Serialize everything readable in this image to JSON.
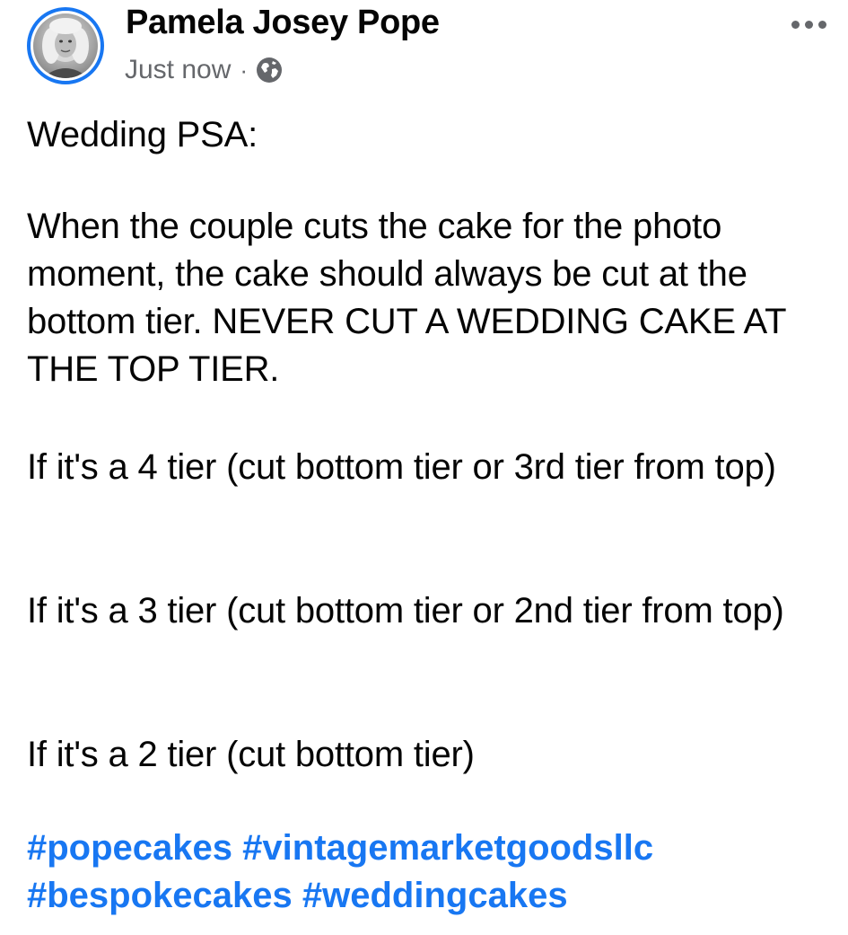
{
  "post": {
    "author": {
      "name": "Pamela Josey Pope",
      "avatar_icon": "profile-photo",
      "avatar_ring_color": "#1877f2"
    },
    "meta": {
      "timestamp": "Just now",
      "separator": "·",
      "audience_icon": "globe-icon"
    },
    "more_icon": "more-horizontal-icon",
    "paragraphs": [
      "Wedding PSA:",
      "When the couple cuts the cake for the photo moment,  the cake should always be cut at the bottom tier. NEVER CUT A WEDDING CAKE AT THE TOP TIER.",
      "If it's a 4 tier (cut bottom tier or 3rd tier from top)",
      "If it's a 3 tier (cut bottom tier or 2nd tier from top)",
      "If it's a 2 tier (cut bottom tier)"
    ],
    "hashtags": [
      "#popecakes",
      "#vintagemarketgoodsllc",
      "#bespokecakes",
      "#weddingcakes"
    ]
  },
  "colors": {
    "text": "#050505",
    "secondary_text": "#65676b",
    "link": "#1877f2",
    "background": "#ffffff"
  }
}
